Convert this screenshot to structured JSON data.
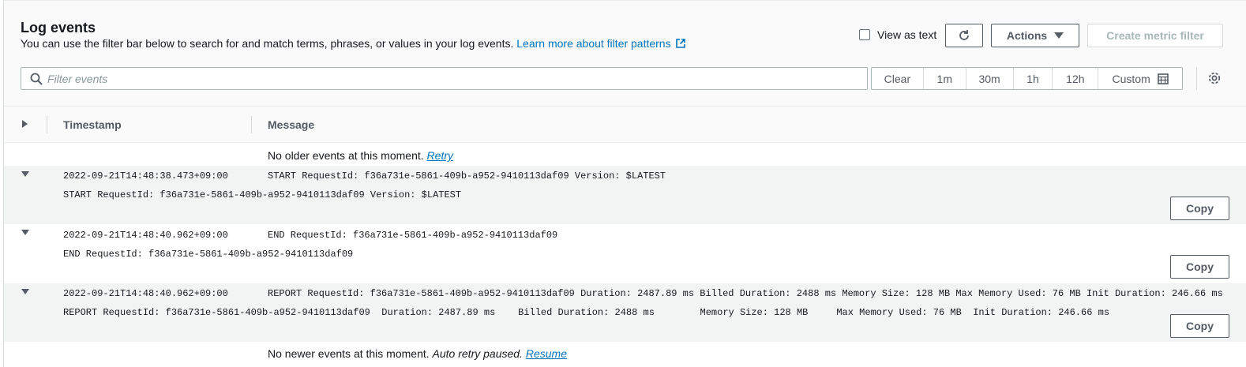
{
  "header": {
    "title": "Log events",
    "description": "You can use the filter bar below to search for and match terms, phrases, or values in your log events.",
    "learn_more_link": "Learn more about filter patterns",
    "view_as_text": "View as text",
    "actions_label": "Actions",
    "create_metric_filter_label": "Create metric filter"
  },
  "filter": {
    "placeholder": "Filter events"
  },
  "time_range": {
    "clear": "Clear",
    "options": [
      "1m",
      "30m",
      "1h",
      "12h"
    ],
    "custom": "Custom"
  },
  "table": {
    "columns": {
      "timestamp": "Timestamp",
      "message": "Message"
    },
    "older_note": "No older events at this moment.",
    "older_retry": "Retry",
    "newer_note": "No newer events at this moment.",
    "newer_paused": "Auto retry paused.",
    "newer_resume": "Resume",
    "copy_label": "Copy",
    "rows": [
      {
        "timestamp": "2022-09-21T14:48:38.473+09:00",
        "message": "START RequestId: f36a731e-5861-409b-a952-9410113daf09 Version: $LATEST",
        "detail": "START RequestId: f36a731e-5861-409b-a952-9410113daf09 Version: $LATEST"
      },
      {
        "timestamp": "2022-09-21T14:48:40.962+09:00",
        "message": "END RequestId: f36a731e-5861-409b-a952-9410113daf09",
        "detail": "END RequestId: f36a731e-5861-409b-a952-9410113daf09"
      },
      {
        "timestamp": "2022-09-21T14:48:40.962+09:00",
        "message": "REPORT RequestId: f36a731e-5861-409b-a952-9410113daf09 Duration: 2487.89 ms Billed Duration: 2488 ms Memory Size: 128 MB Max Memory Used: 76 MB Init Duration: 246.66 ms",
        "detail": "REPORT RequestId: f36a731e-5861-409b-a952-9410113daf09  Duration: 2487.89 ms    Billed Duration: 2488 ms        Memory Size: 128 MB     Max Memory Used: 76 MB  Init Duration: 246.66 ms"
      }
    ]
  },
  "colors": {
    "link": "#0073bb",
    "text": "#16191f",
    "muted": "#545b64",
    "shaded_row": "#f2f3f3"
  }
}
